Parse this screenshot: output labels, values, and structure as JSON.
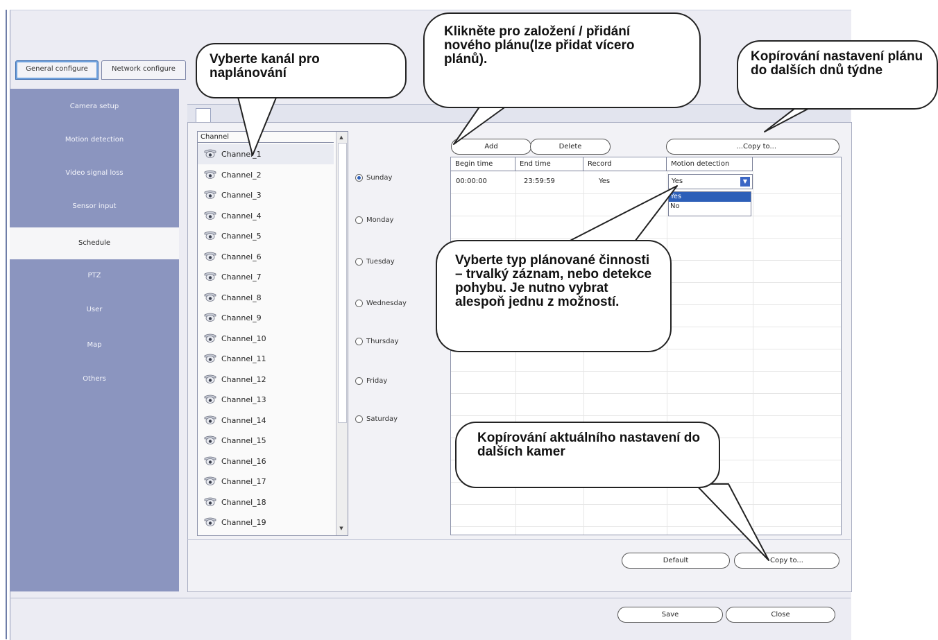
{
  "tabs": [
    "General configure",
    "Network configure"
  ],
  "sidebar": {
    "items": [
      "Camera setup",
      "Motion detection",
      "Video signal loss",
      "Sensor input",
      "Schedule",
      "PTZ",
      "User",
      "Map",
      "Others"
    ],
    "active": "Schedule"
  },
  "channel_list": {
    "header": "Channel",
    "items": [
      "Channel_1",
      "Channel_2",
      "Channel_3",
      "Channel_4",
      "Channel_5",
      "Channel_6",
      "Channel_7",
      "Channel_8",
      "Channel_9",
      "Channel_10",
      "Channel_11",
      "Channel_12",
      "Channel_13",
      "Channel_14",
      "Channel_15",
      "Channel_16",
      "Channel_17",
      "Channel_18",
      "Channel_19"
    ],
    "selected": "Channel_1"
  },
  "days": {
    "items": [
      "Sunday",
      "Monday",
      "Tuesday",
      "Wednesday",
      "Thursday",
      "Friday",
      "Saturday"
    ],
    "selected": "Sunday"
  },
  "schedule_buttons": {
    "add": "Add",
    "delete": "Delete",
    "copy_to": "...Copy to..."
  },
  "grid": {
    "columns": [
      "Begin time",
      "End time",
      "Record",
      "Motion detection"
    ],
    "rows": [
      {
        "begin": "00:00:00",
        "end": "23:59:59",
        "record": "Yes",
        "motion": "Yes"
      }
    ]
  },
  "motion_dropdown": {
    "value": "Yes",
    "options": [
      "Yes",
      "No"
    ],
    "highlighted": "Yes"
  },
  "bottom_buttons": {
    "default": "Default",
    "copy_to": "Copy to..."
  },
  "footer_buttons": {
    "save": "Save",
    "close": "Close"
  },
  "callouts": {
    "select_channel": "Vyberte kanál pro naplánování",
    "add_plan": "Klikněte pro založení / přidání nového plánu(lze přidat vícero plánů).",
    "copy_days": "Kopírování nastavení plánu do dalších dnů týdne",
    "record_type": "Vyberte typ plánované činnosti – trvalký záznam, nebo detekce pohybu. Je nutno vybrat alespoň jednu z možností.",
    "copy_cameras": "Kopírování aktuálního nastavení do dalších kamer"
  },
  "colors": {
    "sidebar": "#8b95bf",
    "selection": "#2d5fb8",
    "accent": "#3f6fb0"
  }
}
